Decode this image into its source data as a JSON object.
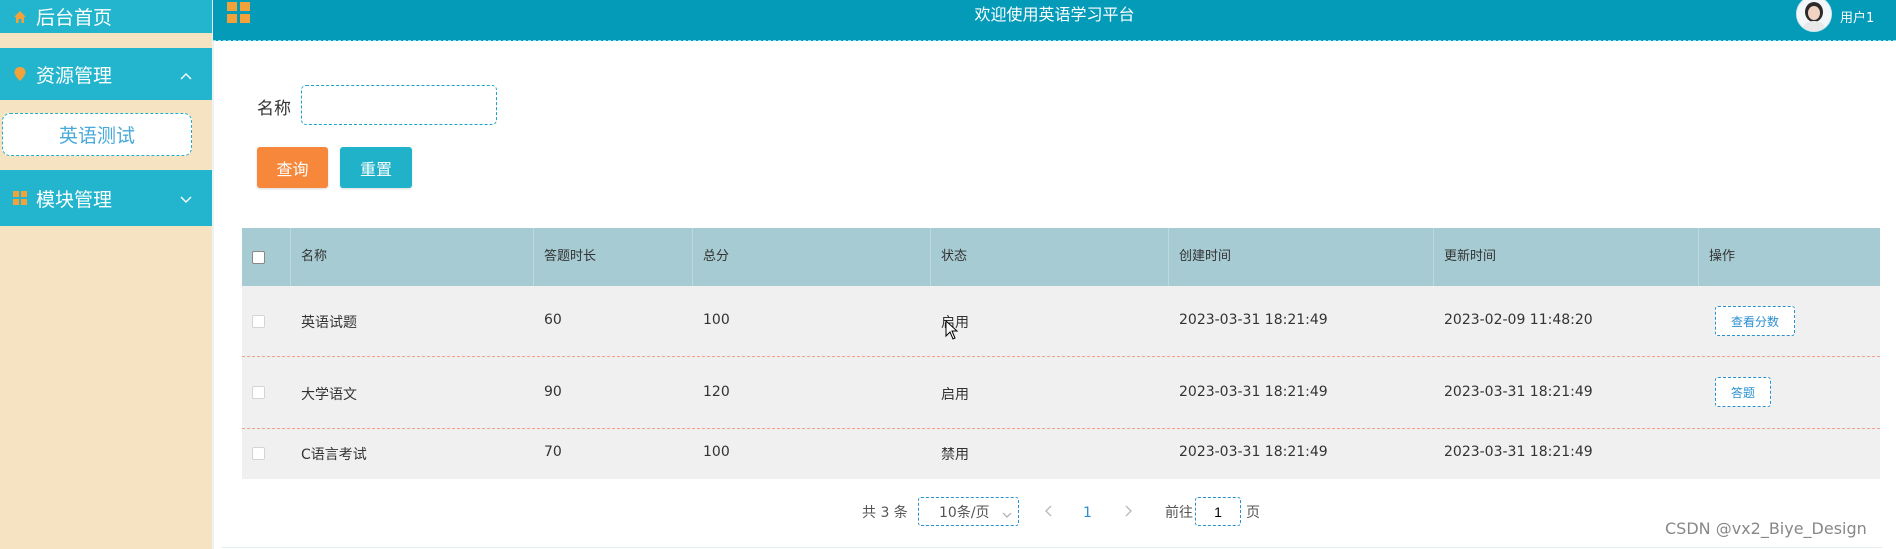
{
  "sidebar": {
    "home_label": "后台首页",
    "resource_label": "资源管理",
    "resource_sub_label": "英语测试",
    "module_label": "模块管理"
  },
  "header": {
    "title": "欢迎使用英语学习平台",
    "user_name": "用户1"
  },
  "search": {
    "name_label": "名称",
    "name_value": "",
    "query_button": "查询",
    "reset_button": "重置"
  },
  "table": {
    "columns": [
      "名称",
      "答题时长",
      "总分",
      "状态",
      "创建时间",
      "更新时间",
      "操作"
    ],
    "rows": [
      {
        "name": "英语试题",
        "duration": "60",
        "total": "100",
        "status": "启用",
        "created": "2023-03-31 18:21:49",
        "updated": "2023-02-09 11:48:20",
        "action": "查看分数"
      },
      {
        "name": "大学语文",
        "duration": "90",
        "total": "120",
        "status": "启用",
        "created": "2023-03-31 18:21:49",
        "updated": "2023-03-31 18:21:49",
        "action": "答题"
      },
      {
        "name": "C语言考试",
        "duration": "70",
        "total": "100",
        "status": "禁用",
        "created": "2023-03-31 18:21:49",
        "updated": "2023-03-31 18:21:49",
        "action": ""
      }
    ]
  },
  "pagination": {
    "total_text": "共 3 条",
    "page_size": "10条/页",
    "current_page": "1",
    "goto_prefix": "前往",
    "goto_value": "1",
    "goto_suffix": "页"
  },
  "watermark": "CSDN @vx2_Biye_Design",
  "colors": {
    "sidebar_bg": "#f5e3c1",
    "menu_bg": "#22b5cd",
    "topbar_bg": "#049bb9",
    "header_row_bg": "#a7cbd2",
    "query_button": "#f7873b",
    "reset_button": "#1fb2c9",
    "link_blue": "#2a8fcf"
  },
  "icons": {
    "home": "home-icon",
    "resource": "pin-icon",
    "module": "grid-icon",
    "topbar": "grid-icon",
    "expand": "chevron-up-icon",
    "collapse": "chevron-down-icon"
  }
}
